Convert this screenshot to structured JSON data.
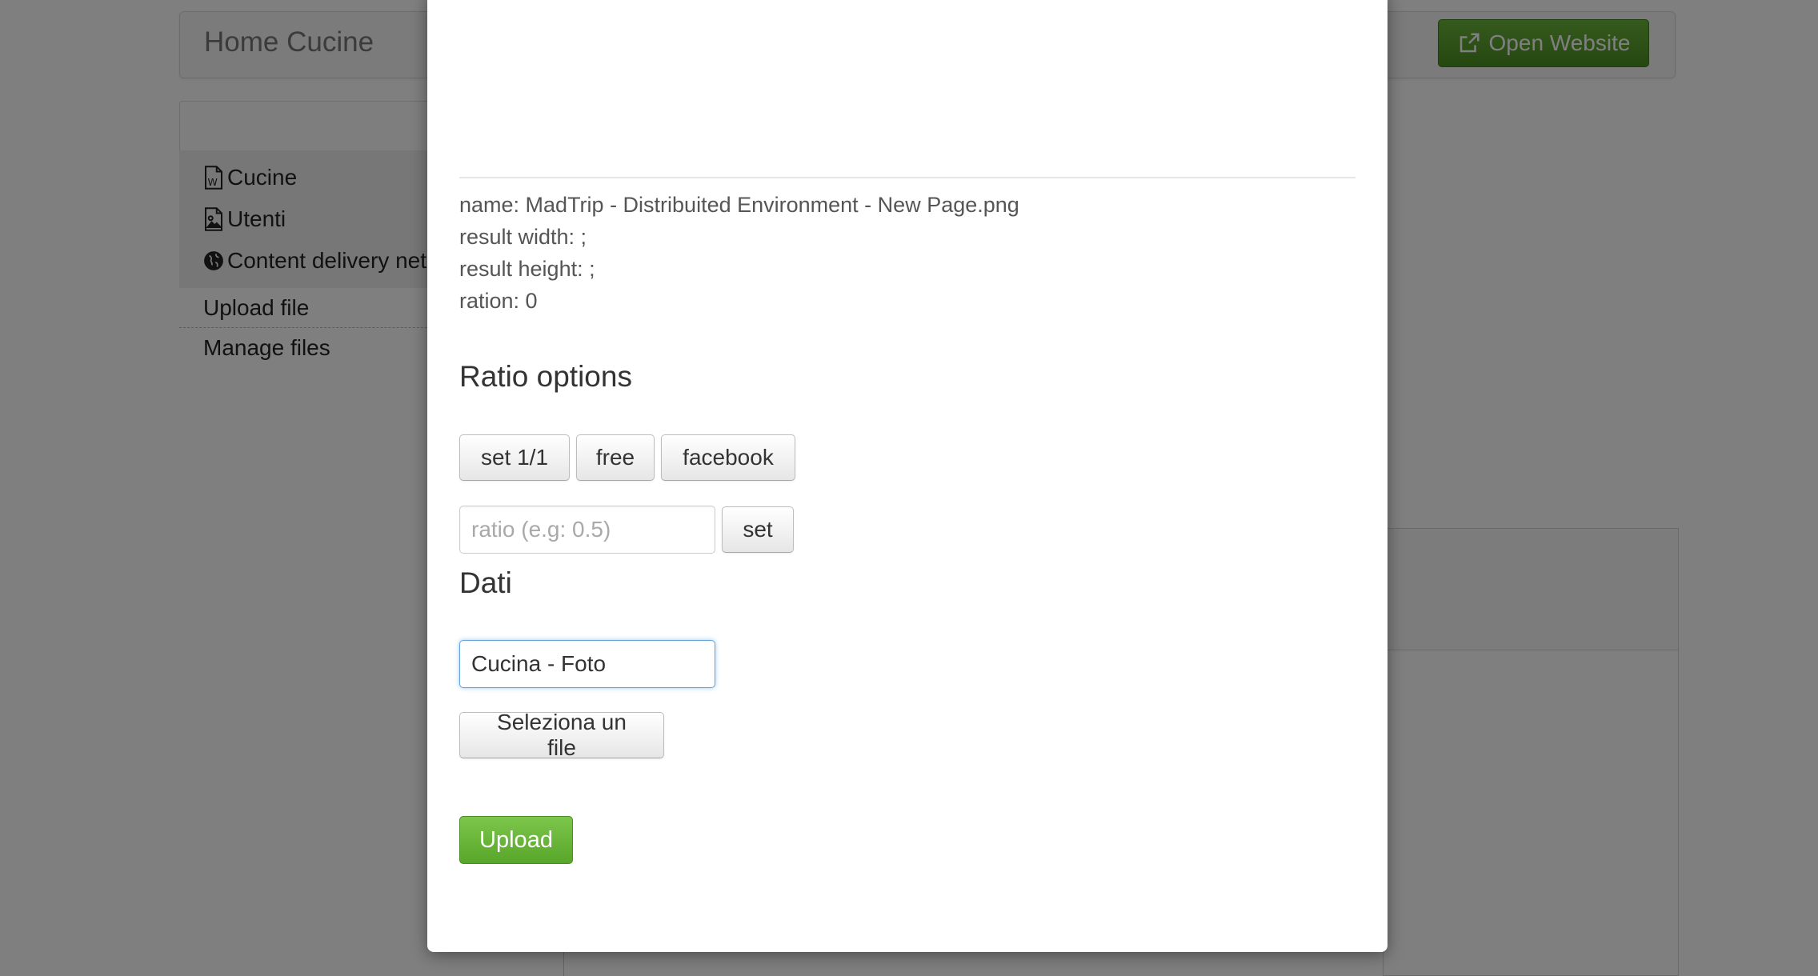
{
  "app": {
    "brand": "Home Cucine",
    "open_website_label": "Open Website",
    "accent_color": "#58a62a"
  },
  "sidebar": {
    "items": [
      {
        "label": "Cucine",
        "icon": "word-file-icon"
      },
      {
        "label": "Utenti",
        "icon": "image-file-icon"
      },
      {
        "label": "Content delivery net",
        "icon": "globe-icon"
      }
    ],
    "links": [
      {
        "label": "Upload file"
      },
      {
        "label": "Manage files"
      }
    ]
  },
  "modal": {
    "info": {
      "name": "name: MadTrip - Distribuited Environment - New Page.png",
      "result_width": "result width: ;",
      "result_height": "result height: ;",
      "ration": "ration: 0"
    },
    "ratio_options": {
      "heading": "Ratio options",
      "buttons": [
        "set 1/1",
        "free",
        "facebook"
      ],
      "ratio_placeholder": "ratio (e.g: 0.5)",
      "set_label": "set"
    },
    "dati": {
      "heading": "Dati",
      "title_value": "Cucina - Foto",
      "select_file_label": "Seleziona un file"
    },
    "upload_label": "Upload"
  }
}
